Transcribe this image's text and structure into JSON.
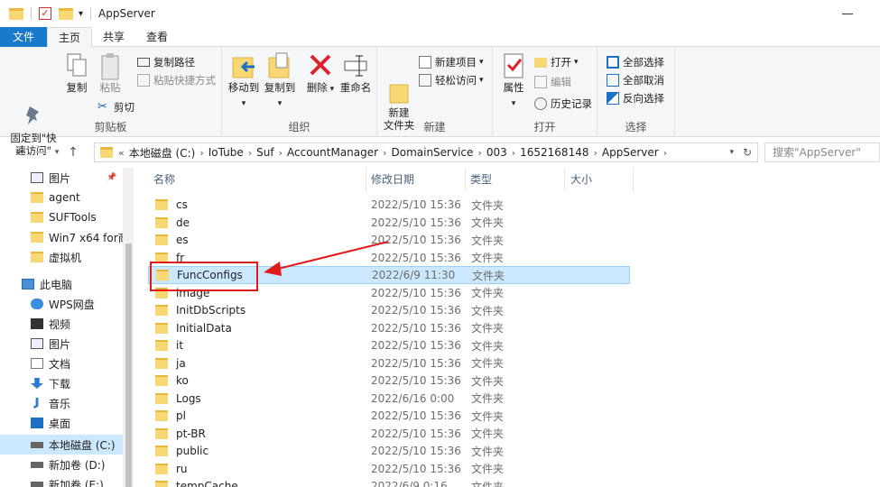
{
  "window": {
    "title": "AppServer"
  },
  "ribbon_tabs": [
    "文件",
    "主页",
    "共享",
    "查看"
  ],
  "ribbon": {
    "pin_quick_access": "固定到\"快速访问\"",
    "copy": "复制",
    "paste": "粘贴",
    "copy_path": "复制路径",
    "paste_shortcut": "粘贴快捷方式",
    "cut": "剪切",
    "clipboard_group": "剪贴板",
    "move_to": "移动到",
    "copy_to": "复制到",
    "delete": "删除",
    "rename": "重命名",
    "organize_group": "组织",
    "new_folder": "新建\n文件夹",
    "new_item": "新建项目",
    "easy_access": "轻松访问",
    "new_group": "新建",
    "properties": "属性",
    "open": "打开",
    "edit": "编辑",
    "history": "历史记录",
    "open_group": "打开",
    "select_all": "全部选择",
    "select_none": "全部取消",
    "invert_selection": "反向选择",
    "select_group": "选择"
  },
  "address": {
    "crumbs": [
      "本地磁盘 (C:)",
      "IoTube",
      "Suf",
      "AccountManager",
      "DomainService",
      "003",
      "1652168148",
      "AppServer"
    ],
    "search_placeholder": "搜索\"AppServer\""
  },
  "nav_pane": [
    {
      "label": "图片",
      "icon": "pictures-icon"
    },
    {
      "label": "agent",
      "icon": "folder-icon"
    },
    {
      "label": "SUFTools",
      "icon": "folder-icon"
    },
    {
      "label": "Win7 x64 for商",
      "icon": "folder-icon"
    },
    {
      "label": "虚拟机",
      "icon": "folder-icon"
    },
    {
      "label": "此电脑",
      "icon": "computer-icon"
    },
    {
      "label": "WPS网盘",
      "icon": "cloud-icon"
    },
    {
      "label": "视频",
      "icon": "video-icon"
    },
    {
      "label": "图片",
      "icon": "pictures-icon"
    },
    {
      "label": "文档",
      "icon": "documents-icon"
    },
    {
      "label": "下载",
      "icon": "download-icon"
    },
    {
      "label": "音乐",
      "icon": "music-icon"
    },
    {
      "label": "桌面",
      "icon": "desktop-icon"
    },
    {
      "label": "本地磁盘 (C:)",
      "icon": "drive-icon"
    },
    {
      "label": "新加卷 (D:)",
      "icon": "drive-icon"
    },
    {
      "label": "新加卷 (E:)",
      "icon": "drive-icon"
    }
  ],
  "columns": [
    "名称",
    "修改日期",
    "类型",
    "大小"
  ],
  "files": [
    {
      "name": "cs",
      "date": "2022/5/10 15:36",
      "type": "文件夹"
    },
    {
      "name": "de",
      "date": "2022/5/10 15:36",
      "type": "文件夹"
    },
    {
      "name": "es",
      "date": "2022/5/10 15:36",
      "type": "文件夹"
    },
    {
      "name": "fr",
      "date": "2022/5/10 15:36",
      "type": "文件夹"
    },
    {
      "name": "FuncConfigs",
      "date": "2022/6/9 11:30",
      "type": "文件夹"
    },
    {
      "name": "image",
      "date": "2022/5/10 15:36",
      "type": "文件夹"
    },
    {
      "name": "InitDbScripts",
      "date": "2022/5/10 15:36",
      "type": "文件夹"
    },
    {
      "name": "InitialData",
      "date": "2022/5/10 15:36",
      "type": "文件夹"
    },
    {
      "name": "it",
      "date": "2022/5/10 15:36",
      "type": "文件夹"
    },
    {
      "name": "ja",
      "date": "2022/5/10 15:36",
      "type": "文件夹"
    },
    {
      "name": "ko",
      "date": "2022/5/10 15:36",
      "type": "文件夹"
    },
    {
      "name": "Logs",
      "date": "2022/6/16 0:00",
      "type": "文件夹"
    },
    {
      "name": "pl",
      "date": "2022/5/10 15:36",
      "type": "文件夹"
    },
    {
      "name": "pt-BR",
      "date": "2022/5/10 15:36",
      "type": "文件夹"
    },
    {
      "name": "public",
      "date": "2022/5/10 15:36",
      "type": "文件夹"
    },
    {
      "name": "ru",
      "date": "2022/5/10 15:36",
      "type": "文件夹"
    },
    {
      "name": "tempCache",
      "date": "2022/6/9 0:16",
      "type": "文件夹"
    }
  ],
  "highlighted_row": 4,
  "colors": {
    "accent": "#1979ca",
    "annotation": "#e01b1b",
    "selection": "#cce8ff"
  }
}
